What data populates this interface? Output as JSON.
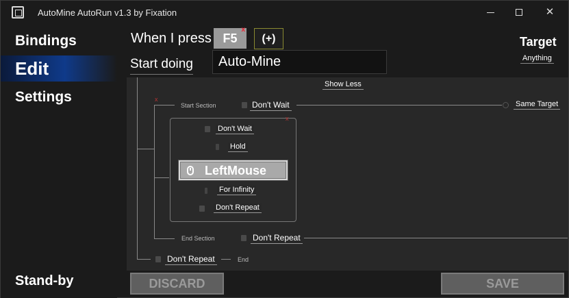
{
  "window": {
    "title": "AutoMine AutoRun v1.3 by Fixation",
    "controls": {
      "minimize_icon": "minimize-icon",
      "maximize_icon": "maximize-icon",
      "close_icon": "close-icon",
      "close_glyph": "✕"
    }
  },
  "sidebar": {
    "items": [
      {
        "label": "Bindings"
      },
      {
        "label": "Edit",
        "active": true
      },
      {
        "label": "Settings"
      }
    ],
    "status": "Stand-by"
  },
  "header": {
    "when_label": "When I press",
    "key": "F5",
    "key_remove": "x",
    "add_key_label": "(+)",
    "start_label": "Start doing",
    "name_value": "Auto-Mine",
    "target_label": "Target",
    "target_value": "Anything"
  },
  "editor": {
    "show_less": "Show Less",
    "start_section": {
      "label": "Start Section",
      "remove": "x",
      "wait": "Don't Wait",
      "target": "Same Target"
    },
    "action": {
      "remove": "x",
      "wait": "Don't Wait",
      "mode": "Hold",
      "key": "LeftMouse",
      "duration": "For Infinity",
      "repeat": "Don't Repeat"
    },
    "end_section": {
      "label": "End Section",
      "repeat": "Don't Repeat"
    },
    "end": {
      "repeat": "Don't Repeat",
      "label": "End"
    }
  },
  "footer": {
    "discard_label": "DISCARD",
    "save_label": "SAVE"
  },
  "colors": {
    "accent": "#0f3a8a",
    "background": "#1b1b1b",
    "editor_bg": "#282828",
    "disabled_button": "#5f5f5f",
    "remove_red": "#e22233"
  }
}
